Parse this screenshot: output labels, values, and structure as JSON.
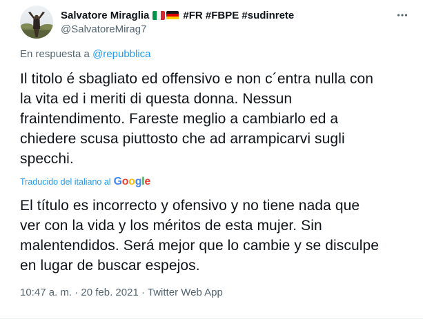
{
  "author": {
    "display_name": "Salvatore Miraglia",
    "hashtags": "#FR #FBPE #sudinrete",
    "handle": "@SalvatoreMirag7",
    "flags": [
      "italy-flag",
      "germany-flag"
    ]
  },
  "reply": {
    "prefix": "En respuesta a",
    "target": "@repubblica"
  },
  "tweet": {
    "original_lines": [
      "Il titolo é sbagliato ed offensivo e non c´entra nulla con",
      "la vita ed i meriti di questa donna. Nessun",
      "fraintendimento. Fareste meglio a cambiarlo ed a",
      "chiedere scusa piuttosto che ad arrampicarvi sugli",
      "specchi."
    ],
    "translated_label": "Traducido del italiano al",
    "translation_provider": "Google",
    "translated_lines": [
      "El título es incorrecto y ofensivo y no tiene nada que",
      "ver con la vida y los méritos de esta mujer. Sin",
      "malentendidos. Será mejor que lo cambie y se disculpe",
      "en lugar de buscar espejos."
    ]
  },
  "meta": {
    "time": "10:47 a. m.",
    "sep1": "·",
    "date": "20 feb. 2021",
    "sep2": "·",
    "source": "Twitter Web App"
  },
  "colors": {
    "link": "#1d9bf0",
    "text": "#0f1419",
    "secondary": "#536471"
  }
}
